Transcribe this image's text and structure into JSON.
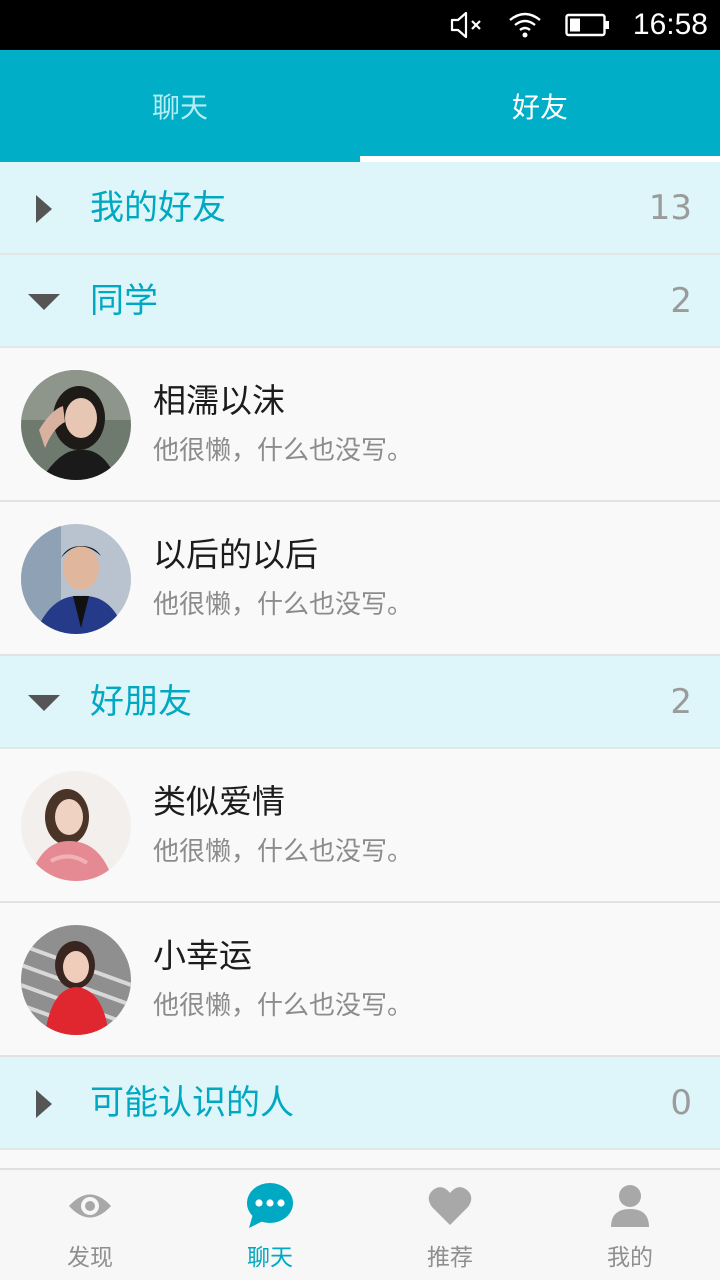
{
  "status_bar": {
    "time": "16:58",
    "icons": [
      "mute-icon",
      "wifi-icon",
      "battery-icon"
    ]
  },
  "top_tabs": [
    {
      "label": "聊天",
      "active": false
    },
    {
      "label": "好友",
      "active": true
    }
  ],
  "groups": [
    {
      "title": "我的好友",
      "count": "13",
      "expanded": false,
      "friends": []
    },
    {
      "title": "同学",
      "count": "2",
      "expanded": true,
      "friends": [
        {
          "name": "相濡以沫",
          "signature": "他很懒，什么也没写。"
        },
        {
          "name": "以后的以后",
          "signature": "他很懒，什么也没写。"
        }
      ]
    },
    {
      "title": "好朋友",
      "count": "2",
      "expanded": true,
      "friends": [
        {
          "name": "类似爱情",
          "signature": "他很懒，什么也没写。"
        },
        {
          "name": "小幸运",
          "signature": "他很懒，什么也没写。"
        }
      ]
    },
    {
      "title": "可能认识的人",
      "count": "0",
      "expanded": false,
      "friends": []
    }
  ],
  "bottom_nav": [
    {
      "label": "发现",
      "icon": "eye-icon",
      "active": false
    },
    {
      "label": "聊天",
      "icon": "chat-bubble-icon",
      "active": true
    },
    {
      "label": "推荐",
      "icon": "heart-icon",
      "active": false
    },
    {
      "label": "我的",
      "icon": "person-icon",
      "active": false
    }
  ],
  "colors": {
    "accent": "#00aec7",
    "group_bg": "#def6f9",
    "inactive_icon": "#a8a8a8"
  }
}
